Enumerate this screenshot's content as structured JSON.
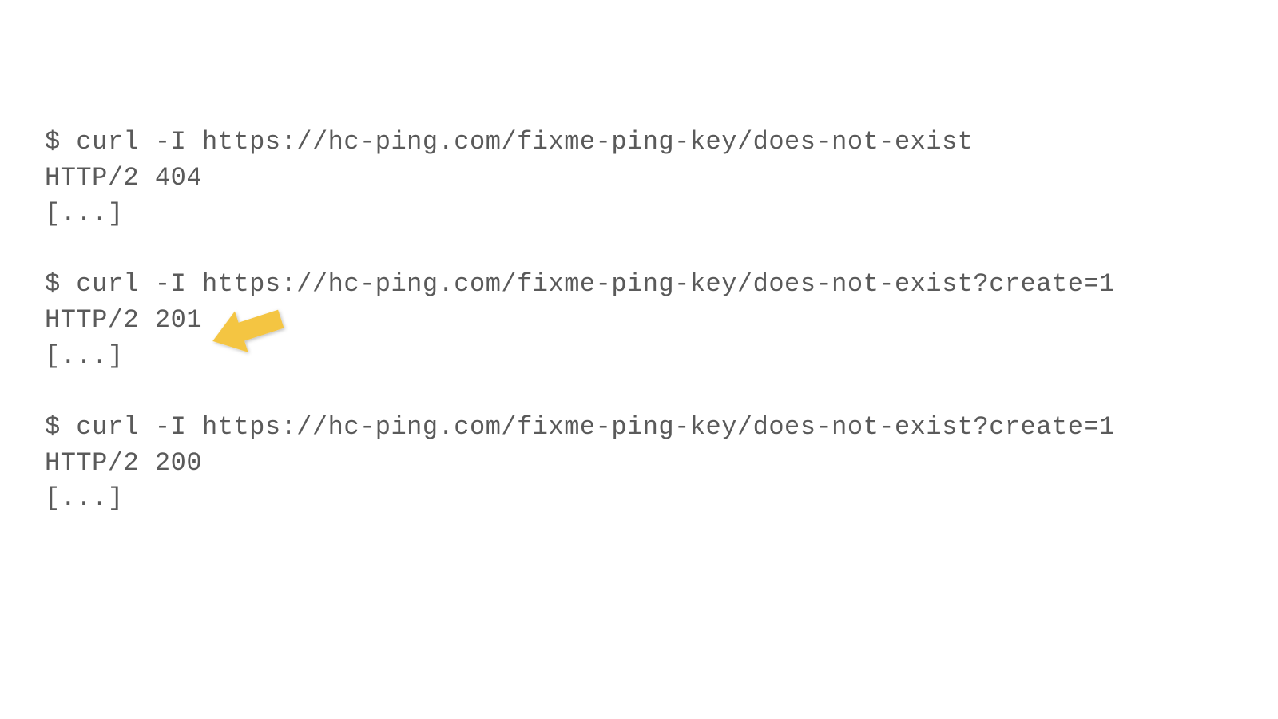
{
  "terminal": {
    "blocks": [
      {
        "command": "$ curl -I https://hc-ping.com/fixme-ping-key/does-not-exist",
        "response": "HTTP/2 404",
        "ellipsis": "[...]"
      },
      {
        "command": "$ curl -I https://hc-ping.com/fixme-ping-key/does-not-exist?create=1",
        "response": "HTTP/2 201",
        "ellipsis": "[...]"
      },
      {
        "command": "$ curl -I https://hc-ping.com/fixme-ping-key/does-not-exist?create=1",
        "response": "HTTP/2 200",
        "ellipsis": "[...]"
      }
    ]
  },
  "annotation": {
    "arrow_color": "#f4c542",
    "arrow_target": "HTTP/2 201"
  }
}
